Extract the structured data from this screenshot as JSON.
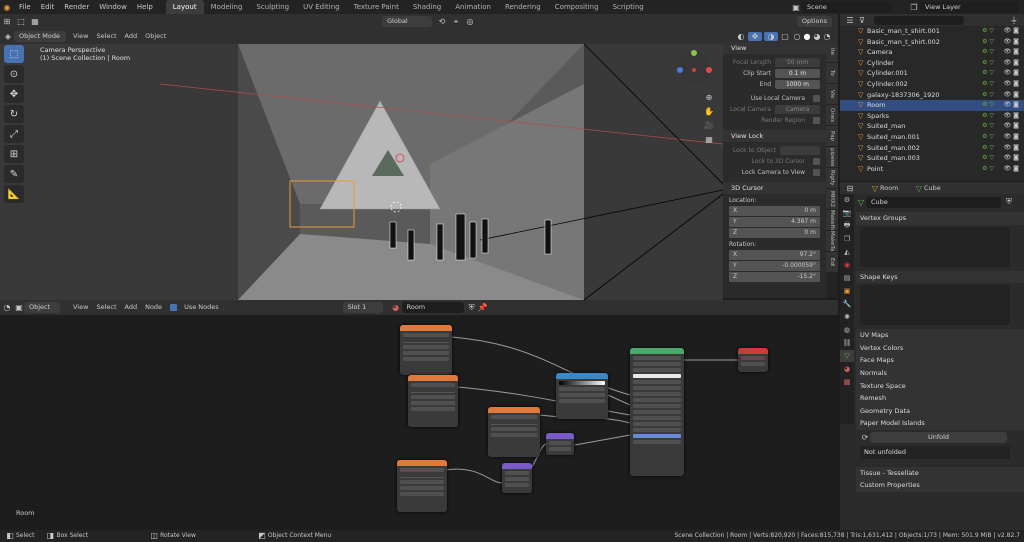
{
  "menu": [
    "File",
    "Edit",
    "Render",
    "Window",
    "Help"
  ],
  "workspaces": [
    "Layout",
    "Modeling",
    "Sculpting",
    "UV Editing",
    "Texture Paint",
    "Shading",
    "Animation",
    "Rendering",
    "Compositing",
    "Scripting"
  ],
  "active_workspace": "Layout",
  "scene": "Scene",
  "view_layer": "View Layer",
  "viewport_header": {
    "mode": "Object Mode",
    "menus": [
      "View",
      "Select",
      "Add",
      "Object"
    ],
    "orientation": "Global",
    "options": "Options"
  },
  "viewport_overlay": {
    "line1": "Camera Perspective",
    "line2": "(1) Scene Collection | Room"
  },
  "npanel": {
    "view_title": "View",
    "focal_length_label": "Focal Length",
    "focal_length": "50 mm",
    "clip_start_label": "Clip Start",
    "clip_start": "0.1 m",
    "end_label": "End",
    "end": "1000 m",
    "use_local_camera": "Use Local Camera",
    "local_camera_label": "Local Camera",
    "local_camera": "Camera",
    "render_region": "Render Region",
    "view_lock_title": "View Lock",
    "lock_to_object": "Lock to Object",
    "lock_to_3d_cursor": "Lock to 3D Cursor",
    "lock_camera_to_view": "Lock Camera to View",
    "cursor_title": "3D Cursor",
    "location_label": "Location:",
    "loc": [
      {
        "a": "X",
        "v": "0 m"
      },
      {
        "a": "Y",
        "v": "4.387 m"
      },
      {
        "a": "Z",
        "v": "0 m"
      }
    ],
    "rotation_label": "Rotation:",
    "rot": [
      {
        "a": "X",
        "v": "97.2°"
      },
      {
        "a": "Y",
        "v": "-0.000059°"
      },
      {
        "a": "Z",
        "v": "-15.2°"
      }
    ]
  },
  "side_tabs": [
    "Ite",
    "To",
    "Vie",
    "Ones",
    "Pap",
    "pipeoe",
    "Rigify",
    "MHX2 Runti",
    "MakeHum",
    "MakeTarg",
    "Edi"
  ],
  "outliner": [
    {
      "name": "Basic_man_t_shirt.001",
      "sel": false
    },
    {
      "name": "Basic_man_t_shirt.002",
      "sel": false
    },
    {
      "name": "Camera",
      "sel": false
    },
    {
      "name": "Cylinder",
      "sel": false
    },
    {
      "name": "Cylinder.001",
      "sel": false
    },
    {
      "name": "Cylinder.002",
      "sel": false
    },
    {
      "name": "galaxy-1837306_1920",
      "sel": false
    },
    {
      "name": "Room",
      "sel": true
    },
    {
      "name": "Sparks",
      "sel": false
    },
    {
      "name": "Suited_man",
      "sel": false
    },
    {
      "name": "Suited_man.001",
      "sel": false
    },
    {
      "name": "Suited_man.002",
      "sel": false
    },
    {
      "name": "Suited_man.003",
      "sel": false
    },
    {
      "name": "Point",
      "sel": false
    }
  ],
  "props": {
    "object": "Room",
    "mesh": "Cube",
    "mesh_field": "Cube",
    "sections": [
      "Vertex Groups",
      "Shape Keys",
      "UV Maps",
      "Vertex Colors",
      "Face Maps",
      "Normals",
      "Texture Space",
      "Remesh",
      "Geometry Data",
      "Paper Model Islands"
    ],
    "unfold": "Unfold",
    "not_unfolded": "Not unfolded",
    "tissue": "Tissue - Tessellate",
    "custom_props": "Custom Properties"
  },
  "node_header": {
    "type": "Object",
    "menus": [
      "View",
      "Select",
      "Add",
      "Node"
    ],
    "use_nodes": "Use Nodes",
    "slot": "Slot 1",
    "material": "Room"
  },
  "node_label": "Room",
  "status": {
    "select": "Select",
    "box_select": "Box Select",
    "rotate_view": "Rotate View",
    "context_menu": "Object Context Menu",
    "stats": "Scene Collection | Room | Verts:820,920 | Faces:815,738 | Tris:1,631,412 | Objects:1/73 | Mem: 501.9 MiB | v2.82.7"
  },
  "colors": {
    "accent": "#4772b3",
    "selected_row": "#334d80",
    "header": "#303030"
  }
}
